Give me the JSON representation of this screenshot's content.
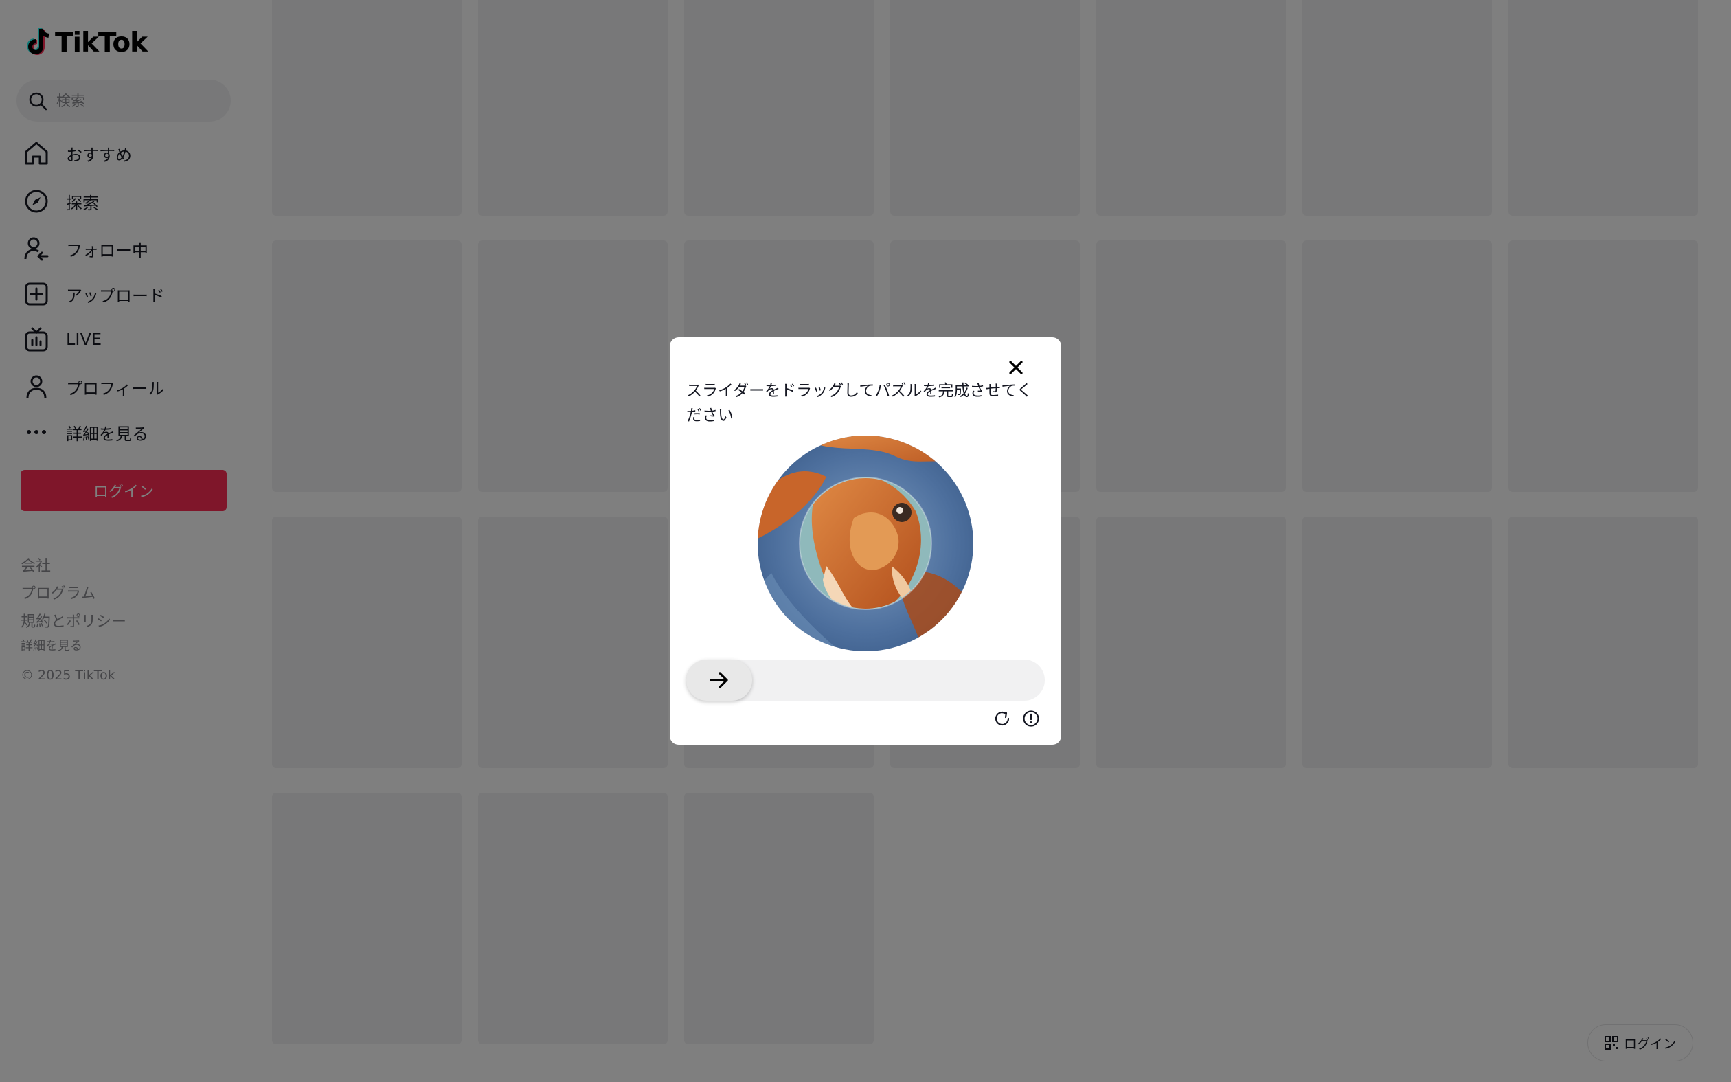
{
  "app": {
    "logo_text": "TikTok"
  },
  "search": {
    "placeholder": "検索"
  },
  "nav": [
    {
      "label": "おすすめ",
      "icon": "home-icon"
    },
    {
      "label": "探索",
      "icon": "compass-icon"
    },
    {
      "label": "フォロー中",
      "icon": "following-icon"
    },
    {
      "label": "アップロード",
      "icon": "upload-icon"
    },
    {
      "label": "LIVE",
      "icon": "live-icon"
    },
    {
      "label": "プロフィール",
      "icon": "profile-icon"
    },
    {
      "label": "詳細を見る",
      "icon": "more-icon"
    }
  ],
  "login_button": "ログイン",
  "footer": {
    "company": "会社",
    "program": "プログラム",
    "terms": "規約とポリシー",
    "more": "詳細を見る",
    "copyright": "© 2025 TikTok"
  },
  "float_login": {
    "label": "ログイン"
  },
  "captcha": {
    "title": "スライダーをドラッグしてパズルを完成させてください",
    "slider_progress": 0
  },
  "colors": {
    "brand": "#fe2c55",
    "text": "#161823",
    "muted": "#8a8b91",
    "tile": "#f1f1f2",
    "overlay": "rgba(0,0,0,0.5)"
  }
}
